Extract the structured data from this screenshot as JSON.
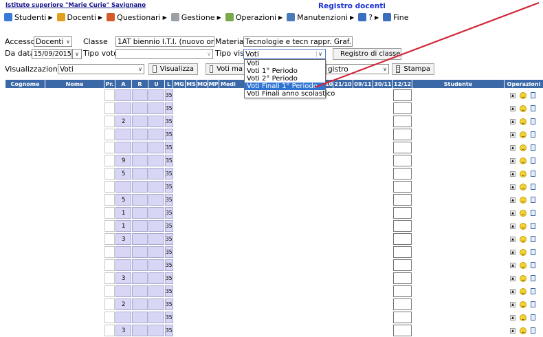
{
  "header": {
    "school_link": "Istituto superiore \"Marie Curie\" Savignano",
    "section_title": "Registro docenti"
  },
  "menu": [
    {
      "label": "Studenti",
      "icon": "students-icon",
      "color": "#3a7bd5"
    },
    {
      "label": "Docenti",
      "icon": "teacher-icon",
      "color": "#e0a020"
    },
    {
      "label": "Questionari",
      "icon": "questionnaire-icon",
      "color": "#d45a2a"
    },
    {
      "label": "Gestione",
      "icon": "management-icon",
      "color": "#9aa0a6"
    },
    {
      "label": "Operazioni",
      "icon": "operations-icon",
      "color": "#7aa84a"
    },
    {
      "label": "Manutenzioni",
      "icon": "maintenance-icon",
      "color": "#4a7ab8"
    },
    {
      "label": "?",
      "icon": "help-icon",
      "color": "#3a6fc0"
    },
    {
      "label": "Fine",
      "icon": "exit-icon",
      "color": "#3a6fc0"
    }
  ],
  "filters": {
    "accesso_label": "Accesso",
    "accesso_value": "Docenti",
    "classe_label": "Classe",
    "classe_value": "1AT biennio I.T.I. (nuovo ord)",
    "materia_label": "Materia",
    "materia_value": "Tecnologie e tecn rappr. Graf.",
    "da_data_label": "Da data",
    "da_data_value": "15/09/2015",
    "tipo_voto_label": "Tipo voto",
    "tipo_voto_value": "",
    "tipo_vis_label": "Tipo vis.",
    "tipo_vis_value": "Voti",
    "registro_button": "Registro di classe",
    "visualizzazione_label": "Visualizzazione",
    "visualizzazione_value": "Voti",
    "visualizza_button": "Visualizza",
    "voti_button": "Voti ma",
    "registro_select_value": "gistro",
    "stampa_button": "Stampa"
  },
  "tipo_vis_options": [
    "Voti",
    "Voti 1° Periodo",
    "Voti 2° Periodo",
    "Voti Finali 1° Periodo",
    "Voti Finali anno scolastico"
  ],
  "tipo_vis_highlighted": "Voti Finali 1° Periodo",
  "table": {
    "headers": {
      "cognome": "Cognome",
      "nome": "Nome",
      "pr": "Pr.",
      "a": "A",
      "r": "R",
      "u": "U",
      "l": "L",
      "mg": "MG",
      "ms": "MS",
      "mo": "MO",
      "mp": "MP",
      "medi": "Medi",
      "d1": "10",
      "d2": "21/10",
      "d3": "09/11",
      "d4": "30/11",
      "d5": "12/12",
      "studente": "Studente",
      "operazioni": "Operazioni"
    },
    "rows": [
      {
        "a": "",
        "l": "35"
      },
      {
        "a": "",
        "l": "35"
      },
      {
        "a": "2",
        "l": "35"
      },
      {
        "a": "",
        "l": "35"
      },
      {
        "a": "",
        "l": "35"
      },
      {
        "a": "9",
        "l": "35"
      },
      {
        "a": "5",
        "l": "35"
      },
      {
        "a": "",
        "l": "35"
      },
      {
        "a": "5",
        "l": "35"
      },
      {
        "a": "1",
        "l": "35"
      },
      {
        "a": "1",
        "l": "35"
      },
      {
        "a": "3",
        "l": "35"
      },
      {
        "a": "",
        "l": "35"
      },
      {
        "a": "",
        "l": "35"
      },
      {
        "a": "3",
        "l": "35"
      },
      {
        "a": "",
        "l": "35"
      },
      {
        "a": "2",
        "l": "35"
      },
      {
        "a": "",
        "l": "35"
      },
      {
        "a": "3",
        "l": "35"
      }
    ]
  },
  "annotation_color": "#d0283a"
}
